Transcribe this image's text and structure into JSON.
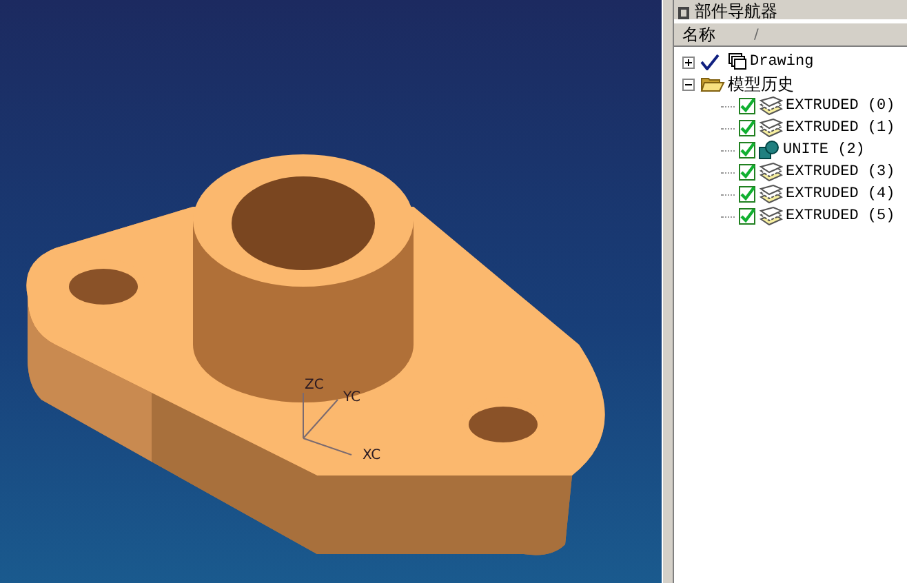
{
  "viewport": {
    "axis_labels": [
      "ZC",
      "YC",
      "XC"
    ]
  },
  "navigator": {
    "title": "部件导航器",
    "columns": [
      {
        "label": "名称",
        "sort_mark": "/"
      }
    ],
    "tree": [
      {
        "label": "Drawing",
        "kind": "drawing",
        "checked": true,
        "expanded": false
      },
      {
        "label": "模型历史",
        "kind": "folder",
        "expanded": true,
        "children": [
          {
            "label": "EXTRUDED (0)",
            "kind": "extrude",
            "checked": true
          },
          {
            "label": "EXTRUDED (1)",
            "kind": "extrude",
            "checked": true
          },
          {
            "label": "UNITE (2)",
            "kind": "unite",
            "checked": true
          },
          {
            "label": "EXTRUDED (3)",
            "kind": "extrude",
            "checked": true
          },
          {
            "label": "EXTRUDED (4)",
            "kind": "extrude",
            "checked": true
          },
          {
            "label": "EXTRUDED (5)",
            "kind": "extrude",
            "checked": true
          }
        ]
      }
    ]
  }
}
